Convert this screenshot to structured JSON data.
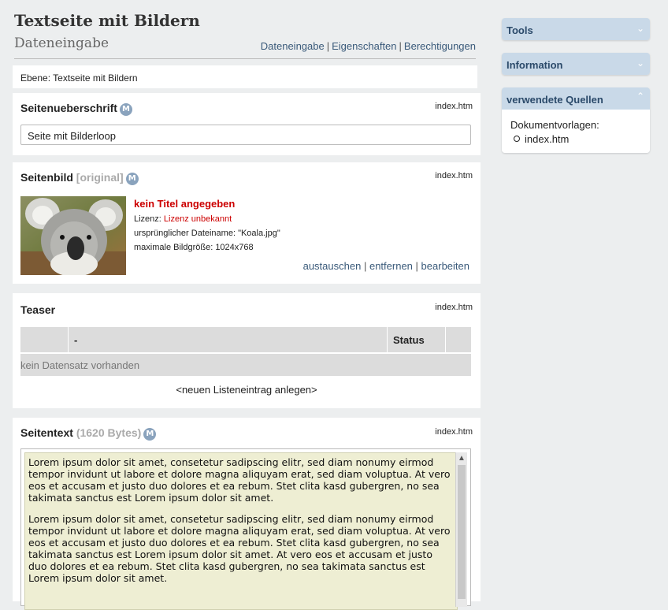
{
  "header": {
    "title": "Textseite mit Bildern",
    "subtitle": "Dateneingabe",
    "links": [
      "Dateneingabe",
      "Eigenschaften",
      "Berechtigungen"
    ],
    "separator": "|"
  },
  "ebene": {
    "text": "Ebene: Textseite mit Bildern"
  },
  "seitenueberschrift": {
    "label": "Seitenueberschrift",
    "source": "index.htm",
    "value": "Seite mit Bilderloop"
  },
  "seitenbild": {
    "label": "Seitenbild",
    "label_muted": "[original]",
    "source": "index.htm",
    "image_title": "kein Titel angegeben",
    "license_label": "Lizenz: ",
    "license_value": "Lizenz unbekannt",
    "filename": "ursprünglicher Dateiname: \"Koala.jpg\"",
    "max_size": "maximale Bildgröße: 1024x768",
    "actions": [
      "austauschen",
      "entfernen",
      "bearbeiten"
    ]
  },
  "teaser": {
    "label": "Teaser",
    "source": "index.htm",
    "columns": [
      "",
      "-",
      "Status",
      ""
    ],
    "empty_text": "kein Datensatz vorhanden",
    "new_entry": "<neuen Listeneintrag anlegen>"
  },
  "seitentext": {
    "label": "Seitentext",
    "label_muted": "(1620 Bytes)",
    "source": "index.htm",
    "paragraphs": [
      "Lorem ipsum dolor sit amet, consetetur sadipscing elitr, sed diam nonumy eirmod tempor invidunt ut labore et dolore magna aliquyam erat, sed diam voluptua. At vero eos et accusam et justo duo dolores et ea rebum. Stet clita kasd gubergren, no sea takimata sanctus est Lorem ipsum dolor sit amet.",
      "Lorem ipsum dolor sit amet, consetetur sadipscing elitr, sed diam nonumy eirmod tempor invidunt ut labore et dolore magna aliquyam erat, sed diam voluptua. At vero eos et accusam et justo duo dolores et ea rebum. Stet clita kasd gubergren, no sea takimata sanctus est Lorem ipsum dolor sit amet. At vero eos et accusam et justo duo dolores et ea rebum. Stet clita kasd gubergren, no sea takimata sanctus est Lorem ipsum dolor sit amet."
    ]
  },
  "m_badge": "M",
  "sidebar": {
    "panels": [
      {
        "title": "Tools",
        "state": "collapsed",
        "icon": "chevron-down-icon"
      },
      {
        "title": "Information",
        "state": "collapsed",
        "icon": "chevron-down-icon"
      },
      {
        "title": "verwendete Quellen",
        "state": "expanded",
        "icon": "chevron-up-icon",
        "body_label": "Dokumentvorlagen:",
        "items": [
          "index.htm"
        ]
      }
    ]
  },
  "colors": {
    "accent": "#3a5a7a",
    "panel_header": "#c9d9e8",
    "error_red": "#cc0000",
    "textarea_bg": "#eeeed3"
  }
}
